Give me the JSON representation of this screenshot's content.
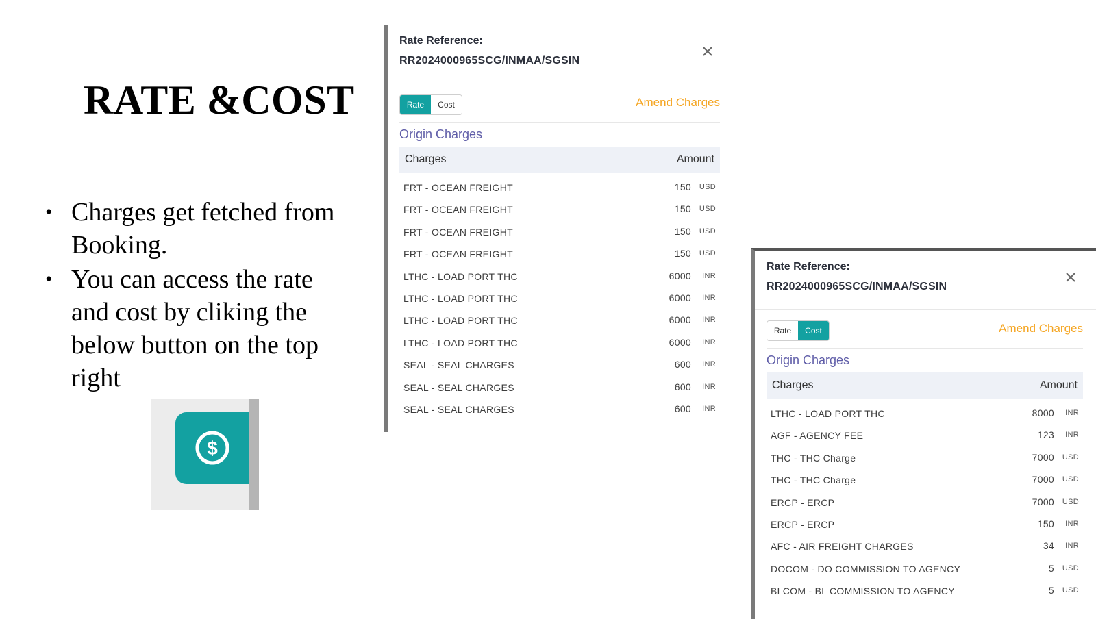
{
  "slide": {
    "title": "RATE &COST",
    "bullets": [
      "Charges get fetched from Booking.",
      "You can access the rate and cost by cliking the below button on the top right"
    ]
  },
  "rate_panel": {
    "label": "Rate Reference:",
    "reference": "RR2024000965SCG/INMAA/SGSIN",
    "toggle": {
      "rate": "Rate",
      "cost": "Cost",
      "active": "rate"
    },
    "amend_label": "Amend Charges",
    "section_title": "Origin Charges",
    "columns": {
      "charges": "Charges",
      "amount": "Amount"
    },
    "rows": [
      {
        "charge": "FRT - OCEAN FREIGHT",
        "amount": "150",
        "currency": "USD"
      },
      {
        "charge": "FRT - OCEAN FREIGHT",
        "amount": "150",
        "currency": "USD"
      },
      {
        "charge": "FRT - OCEAN FREIGHT",
        "amount": "150",
        "currency": "USD"
      },
      {
        "charge": "FRT - OCEAN FREIGHT",
        "amount": "150",
        "currency": "USD"
      },
      {
        "charge": "LTHC - LOAD PORT THC",
        "amount": "6000",
        "currency": "INR"
      },
      {
        "charge": "LTHC - LOAD PORT THC",
        "amount": "6000",
        "currency": "INR"
      },
      {
        "charge": "LTHC - LOAD PORT THC",
        "amount": "6000",
        "currency": "INR"
      },
      {
        "charge": "LTHC - LOAD PORT THC",
        "amount": "6000",
        "currency": "INR"
      },
      {
        "charge": "SEAL - SEAL CHARGES",
        "amount": "600",
        "currency": "INR"
      },
      {
        "charge": "SEAL - SEAL CHARGES",
        "amount": "600",
        "currency": "INR"
      },
      {
        "charge": "SEAL - SEAL CHARGES",
        "amount": "600",
        "currency": "INR"
      }
    ]
  },
  "cost_panel": {
    "label": "Rate Reference:",
    "reference": "RR2024000965SCG/INMAA/SGSIN",
    "toggle": {
      "rate": "Rate",
      "cost": "Cost",
      "active": "cost"
    },
    "amend_label": "Amend Charges",
    "section_title": "Origin Charges",
    "columns": {
      "charges": "Charges",
      "amount": "Amount"
    },
    "rows": [
      {
        "charge": "LTHC - LOAD PORT THC",
        "amount": "8000",
        "currency": "INR"
      },
      {
        "charge": "AGF - AGENCY FEE",
        "amount": "123",
        "currency": "INR"
      },
      {
        "charge": "THC - THC Charge",
        "amount": "7000",
        "currency": "USD"
      },
      {
        "charge": "THC - THC Charge",
        "amount": "7000",
        "currency": "USD"
      },
      {
        "charge": "ERCP - ERCP",
        "amount": "7000",
        "currency": "USD"
      },
      {
        "charge": "ERCP - ERCP",
        "amount": "150",
        "currency": "INR"
      },
      {
        "charge": "AFC - AIR FREIGHT CHARGES",
        "amount": "34",
        "currency": "INR"
      },
      {
        "charge": "DOCOM - DO COMMISSION TO AGENCY",
        "amount": "5",
        "currency": "USD"
      },
      {
        "charge": "BLCOM - BL COMMISSION TO AGENCY",
        "amount": "5",
        "currency": "USD"
      }
    ]
  },
  "icons": {
    "dollar_button": "dollar-circle-icon",
    "close": "close-icon"
  },
  "colors": {
    "accent": "#13a1a1",
    "amend": "#f5a623",
    "section": "#5f5da8",
    "table_header_bg": "#eef1f7"
  }
}
